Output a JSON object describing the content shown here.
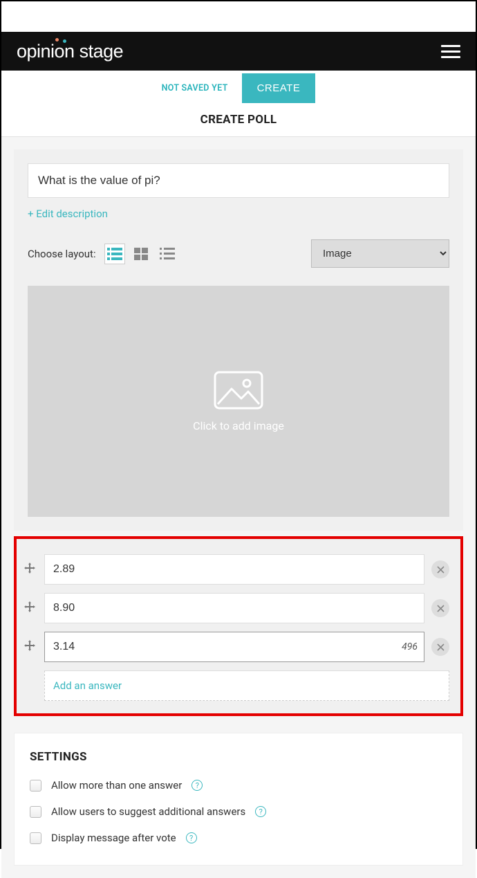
{
  "header": {
    "logo_text": "opinion stage"
  },
  "actionbar": {
    "status": "NOT SAVED YET",
    "create_label": "CREATE"
  },
  "page_title": "CREATE POLL",
  "poll": {
    "question": "What is the value of pi?",
    "edit_description_label": "+ Edit description",
    "layout_label": "Choose layout:",
    "media_type_selected": "Image",
    "image_upload_text": "Click to add image",
    "answers": [
      {
        "value": "2.89",
        "char_count": null,
        "focused": false
      },
      {
        "value": "8.90",
        "char_count": null,
        "focused": false
      },
      {
        "value": "3.14",
        "char_count": "496",
        "focused": true
      }
    ],
    "add_answer_label": "Add an answer"
  },
  "settings": {
    "title": "SETTINGS",
    "items": [
      {
        "label": "Allow more than one answer",
        "checked": false
      },
      {
        "label": "Allow users to suggest additional answers",
        "checked": false
      },
      {
        "label": "Display message after vote",
        "checked": false
      }
    ]
  }
}
